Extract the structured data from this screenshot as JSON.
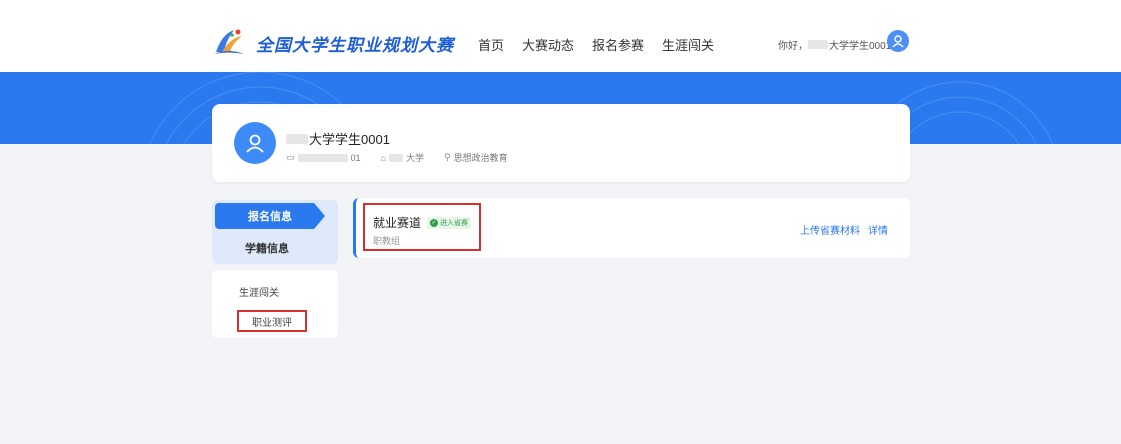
{
  "header": {
    "title": "全国大学生职业规划大赛",
    "nav": [
      "首页",
      "大赛动态",
      "报名参赛",
      "生涯闯关"
    ],
    "greeting_prefix": "你好，",
    "greeting_user": "大学学生0001"
  },
  "profile": {
    "name": "大学学生0001",
    "id_suffix": "01",
    "school": "大学",
    "major": "思想政治教育"
  },
  "side_menu": {
    "tabs": [
      "报名信息",
      "学籍信息"
    ],
    "links": [
      "生涯闯关",
      "职业测评"
    ]
  },
  "track": {
    "title": "就业赛道",
    "status": "进入省赛",
    "group": "职教组",
    "actions": [
      "上传省赛材料",
      "详情"
    ]
  },
  "colors": {
    "primary": "#2b79ee",
    "highlight": "#d9302b",
    "success": "#2e9d45"
  }
}
